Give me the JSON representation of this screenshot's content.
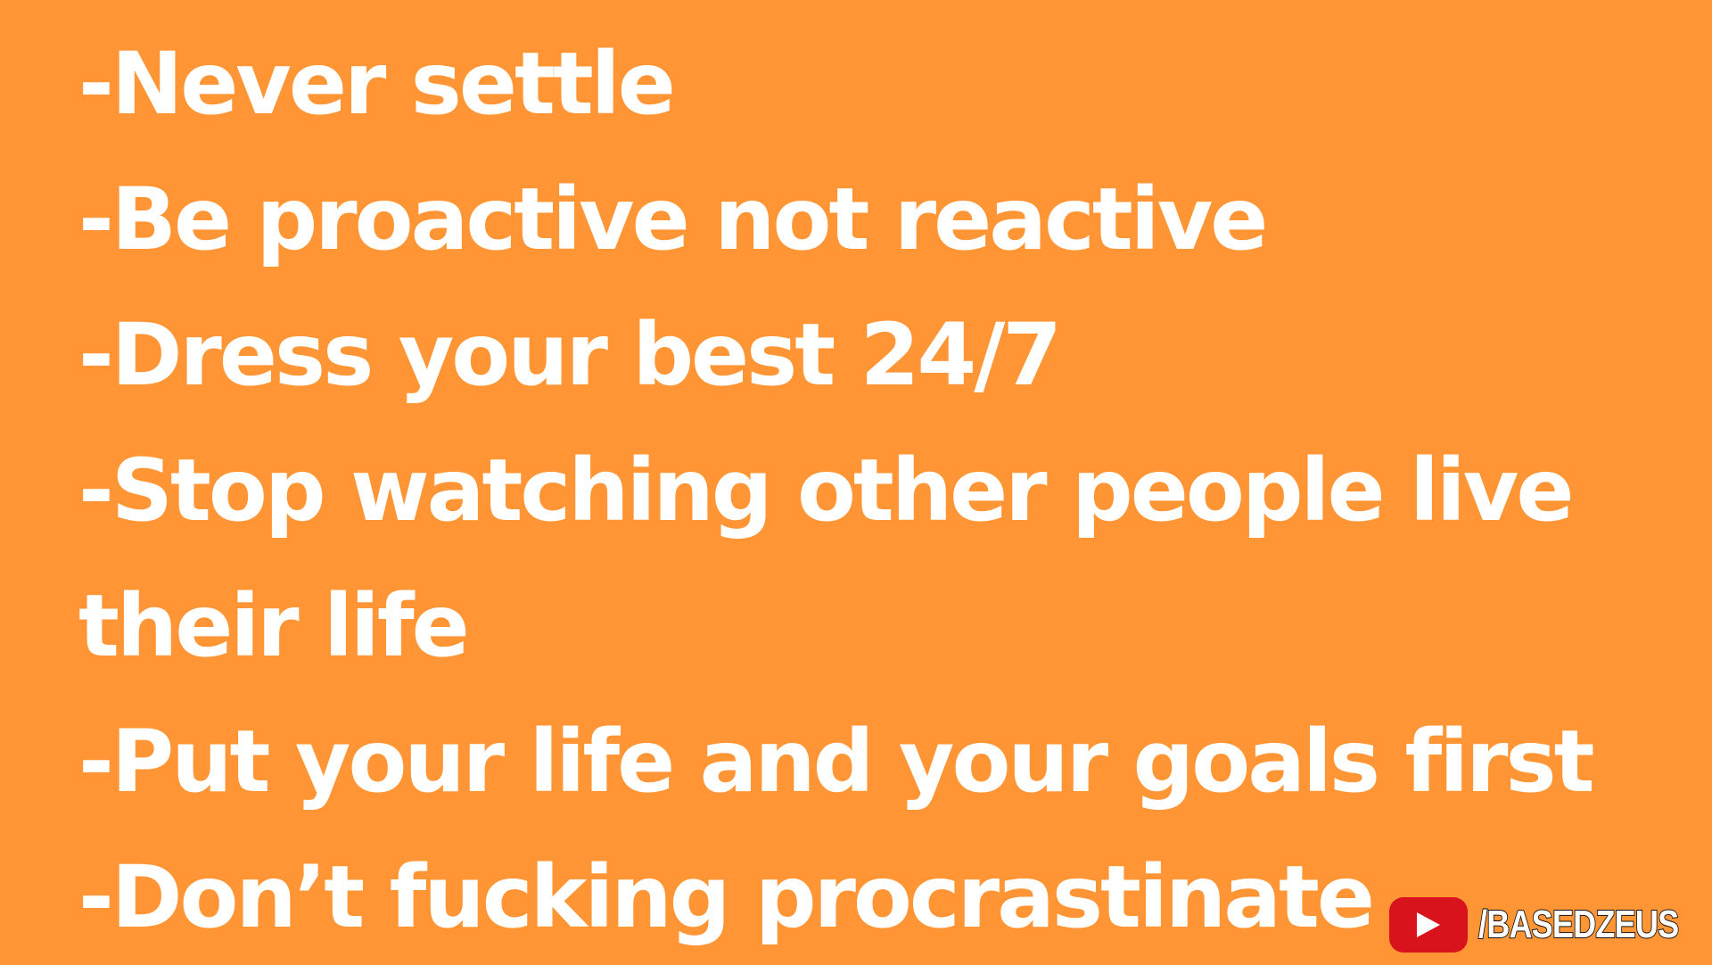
{
  "lines": [
    "-Never settle",
    "-Be proactive not reactive",
    "-Dress your best 24/7",
    "-Stop watching other people live",
    "their life",
    "-Put your life and your goals first",
    "-Don’t fucking procrastinate"
  ],
  "watermark": {
    "icon": "youtube-icon",
    "handle": "/BASEDZEUS"
  },
  "colors": {
    "background": "#FF9534",
    "text": "#FFFFFF",
    "youtube_red": "#D9131B"
  }
}
